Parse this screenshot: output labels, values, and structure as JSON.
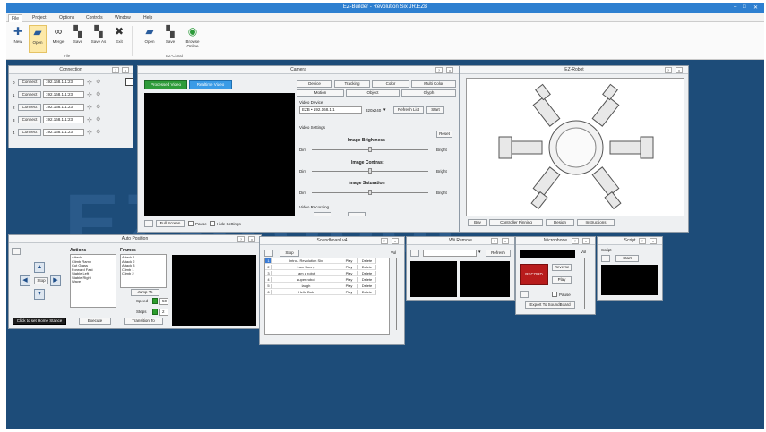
{
  "window": {
    "title": "EZ-Builder - Revolution Six JR.EZB",
    "controls": [
      "–",
      "□",
      "✕"
    ]
  },
  "menu": [
    "File",
    "Project",
    "Options",
    "Controls",
    "Window",
    "Help"
  ],
  "ribbon": {
    "buttons": [
      {
        "label": "New",
        "icon": "✚"
      },
      {
        "label": "Open",
        "icon": "▰"
      },
      {
        "label": "Merge",
        "icon": "∞"
      },
      {
        "label": "Save",
        "icon": "▚"
      },
      {
        "label": "Save As",
        "icon": "▚"
      },
      {
        "label": "Exit",
        "icon": "✖"
      },
      {
        "label": "Open",
        "icon": "▰"
      },
      {
        "label": "Save",
        "icon": "▚"
      },
      {
        "label": "Browse Online",
        "icon": "◉"
      }
    ],
    "groups": [
      "File",
      "EZ-Cloud"
    ]
  },
  "watermark": "EZ-Robot",
  "connection": {
    "title": "Connection",
    "rows": [
      {
        "index": "0",
        "button": "Connect",
        "address": "192.168.1.1:23"
      },
      {
        "index": "1",
        "button": "Connect",
        "address": "192.168.1.1:23"
      },
      {
        "index": "2",
        "button": "Connect",
        "address": "192.168.1.1:23"
      },
      {
        "index": "3",
        "button": "Connect",
        "address": "192.168.1.1:23"
      },
      {
        "index": "4",
        "button": "Connect",
        "address": "192.168.1.1:23"
      }
    ]
  },
  "camera": {
    "title": "Camera",
    "processed_btn": "Processed Video",
    "realtime_btn": "Realtime Video",
    "tabs_row1": [
      "Device",
      "Tracking",
      "Color",
      "Multi Color"
    ],
    "tabs_row2": [
      "Motion",
      "Object",
      "Glyph"
    ],
    "video_device_label": "Video Device",
    "video_device_value": "EZB • 192.168.1.1",
    "resolution_value": "320x240",
    "refresh_btn": "Refresh List",
    "start_btn": "Start",
    "video_settings_label": "Video Settings",
    "reset_btn": "Reset",
    "brightness_label": "Image Brightness",
    "contrast_label": "Image Contrast",
    "saturation_label": "Image Saturation",
    "dim_label": "Dim",
    "bright_label": "Bright",
    "video_recording_label": "Video Recording",
    "fullscreen_btn": "Full Screen",
    "pause_label": "Pause",
    "hide_settings_label": "Hide Settings"
  },
  "ez_robot": {
    "title": "EZ-Robot",
    "tabs": [
      "Buy",
      "Controller Pinning",
      "Design",
      "Instructions"
    ]
  },
  "auto_position": {
    "title": "Auto Position",
    "actions_label": "Actions",
    "actions": [
      "Attack",
      "Climb Ramp",
      "Cut Grass",
      "Forward Fast",
      "Stable Left",
      "Stable Right",
      "Wave"
    ],
    "frames_label": "Frames",
    "frames": [
      "Attack 1",
      "Attack 2",
      "Attack 3",
      "Climb 1",
      "Climb 2"
    ],
    "jump_btn": "Jump To",
    "speed_label": "Speed",
    "speed_value": "50",
    "steps_label": "Steps",
    "steps_value": "2",
    "stop_btn": "Stop",
    "execute_btn": "Execute",
    "transition_btn": "Transition To",
    "status_btn": "Click to set Home Stance"
  },
  "soundboard": {
    "title": "Soundboard v4",
    "stop_btn": "Stop",
    "vol_label": "Vol",
    "rows": [
      {
        "n": "1",
        "name": "Intro - Revolution Six",
        "play": "Play",
        "delete": "Delete"
      },
      {
        "n": "2",
        "name": "I am Sonny",
        "play": "Play",
        "delete": "Delete"
      },
      {
        "n": "3",
        "name": "I am a robot",
        "play": "Play",
        "delete": "Delete"
      },
      {
        "n": "4",
        "name": "super robot",
        "play": "Play",
        "delete": "Delete"
      },
      {
        "n": "5",
        "name": "laugh",
        "play": "Play",
        "delete": "Delete"
      },
      {
        "n": "6",
        "name": "Hello Bob",
        "play": "Play",
        "delete": "Delete"
      }
    ]
  },
  "wii_remote": {
    "title": "Wii Remote",
    "refresh_btn": "Refresh"
  },
  "microphone": {
    "title": "Microphone",
    "vol_label": "Vol",
    "record_btn": "RECORD",
    "reverse_btn": "Reverse",
    "play_btn": "Play",
    "pause_label": "Pause",
    "export_btn": "Export To SoundBoard",
    "record_color": "#b81c1c"
  },
  "script": {
    "title": "Script",
    "label": "Script",
    "start_btn": "Start"
  },
  "colors": {
    "desktop": "#1d4c79",
    "titlebar": "#2d7fd0",
    "green_btn": "#2e9b3a",
    "blue_btn": "#3a9be6"
  }
}
